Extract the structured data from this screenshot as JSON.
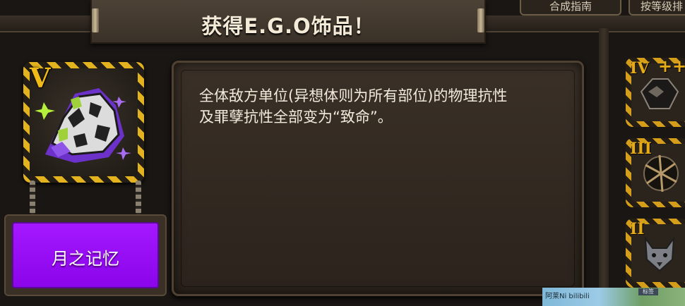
{
  "title": "获得E.G.O饰品！",
  "top_buttons": {
    "synthesis_guide": "合成指南",
    "sort_by_rank": "按等级排"
  },
  "item": {
    "rank": "V",
    "name": "月之记忆",
    "name_color": "#9a10f5",
    "icon": "moon-memory-rock-icon",
    "description_lines": [
      "全体敌方单位(异想体则为所有部位)的物理抗性",
      "及罪孽抗性全部变为“致命”。"
    ]
  },
  "side_cards": [
    {
      "rank": "IV",
      "plus": "++",
      "icon": "dark-mask-icon"
    },
    {
      "rank": "III",
      "icon": "chain-orb-icon"
    },
    {
      "rank": "II",
      "icon": "gray-wolf-icon"
    }
  ],
  "thumbnail": {
    "text": "阿莱Ni bilibili",
    "tag": "标签"
  },
  "colors": {
    "accent_gold": "#e2b21f",
    "background": "#191613",
    "panel": "#34291f"
  }
}
